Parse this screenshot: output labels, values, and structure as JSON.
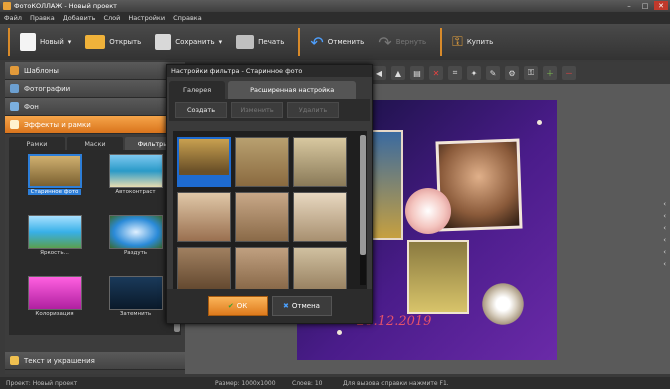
{
  "window": {
    "title": "ФотоКОЛЛАЖ - Новый проект"
  },
  "menu": [
    "Файл",
    "Правка",
    "Добавить",
    "Слой",
    "Настройки",
    "Справка"
  ],
  "toolbar": {
    "new_label": "Новый",
    "open_label": "Открыть",
    "save_label": "Сохранить",
    "print_label": "Печать",
    "undo_label": "Отменить",
    "redo_label": "Вернуть",
    "buy_label": "Купить"
  },
  "left_panel": {
    "sections": [
      "Шаблоны",
      "Фотографии",
      "Фон",
      "Эффекты и рамки"
    ],
    "active_section": "Эффекты и рамки",
    "subtabs": [
      "Рамки",
      "Маски",
      "Фильтры"
    ],
    "active_subtab": "Фильтры",
    "filters": [
      {
        "label": "Старинное фото",
        "selected": true
      },
      {
        "label": "Автоконтраст",
        "selected": false
      },
      {
        "label": "Яркость...",
        "selected": false
      },
      {
        "label": "Раздуть",
        "selected": false
      },
      {
        "label": "Колоризация",
        "selected": false
      },
      {
        "label": "Затемнить",
        "selected": false
      }
    ],
    "bottom_section": "Текст и украшения"
  },
  "dialog": {
    "title": "Настройки фильтра - Старинное фото",
    "tabs": [
      "Галерея",
      "Расширенная настройка"
    ],
    "active_tab": "Расширенная настройка",
    "create_label": "Создать",
    "edit_label": "Изменить",
    "delete_label": "Удалить",
    "ok_label": "ОК",
    "cancel_label": "Отмена"
  },
  "canvas": {
    "date_text": "20.12.2019"
  },
  "status": {
    "project": "Проект: Новый проект",
    "size": "Размер: 1000x1000",
    "layers": "Слоев: 10",
    "help": "Для вызова справки нажмите F1."
  },
  "colors": {
    "accent": "#e08a2a",
    "selection": "#2d7ed8"
  }
}
